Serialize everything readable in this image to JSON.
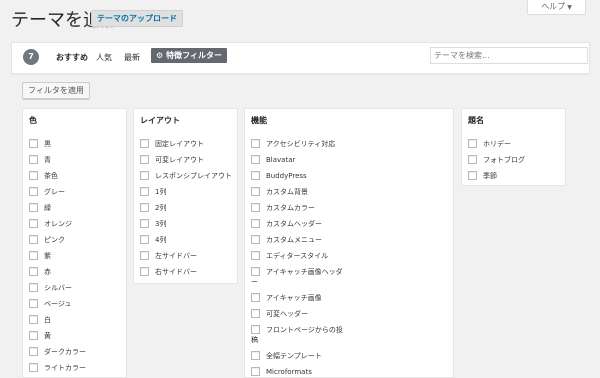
{
  "header": {
    "title": "テーマを追加",
    "upload_label": "テーマのアップロード",
    "help_label": "ヘルプ"
  },
  "filterbar": {
    "count": "7",
    "tabs": [
      "おすすめ",
      "人気",
      "最新"
    ],
    "feature_filter_label": "特徴フィルター",
    "search_placeholder": "テーマを検索..."
  },
  "apply_label": "フィルタを適用",
  "filters": {
    "color": {
      "title": "色",
      "options": [
        "黒",
        "青",
        "茶色",
        "グレー",
        "緑",
        "オレンジ",
        "ピンク",
        "紫",
        "赤",
        "シルバー",
        "ベージュ",
        "白",
        "黄",
        "ダークカラー",
        "ライトカラー"
      ]
    },
    "layout": {
      "title": "レイアウト",
      "options": [
        "固定レイアウト",
        "可変レイアウト",
        "レスポンシブレイアウト",
        "1列",
        "2列",
        "3列",
        "4列",
        "左サイドバー",
        "右サイドバー"
      ]
    },
    "feature": {
      "title": "機能",
      "options": [
        "アクセシビリティ対応",
        "Blavatar",
        "BuddyPress",
        "カスタム背景",
        "カスタムカラー",
        "カスタムヘッダー",
        "カスタムメニュー",
        "エディタースタイル",
        "アイキャッチ画像ヘッダ",
        "アイキャッチ画像",
        "可変ヘッダー",
        "フロントページからの投",
        "全幅テンプレート",
        "Microformats"
      ],
      "wrap_8": "ー",
      "wrap_11": "稿"
    },
    "subject": {
      "title": "題名",
      "options": [
        "ホリデー",
        "フォトブログ",
        "季節"
      ]
    }
  }
}
